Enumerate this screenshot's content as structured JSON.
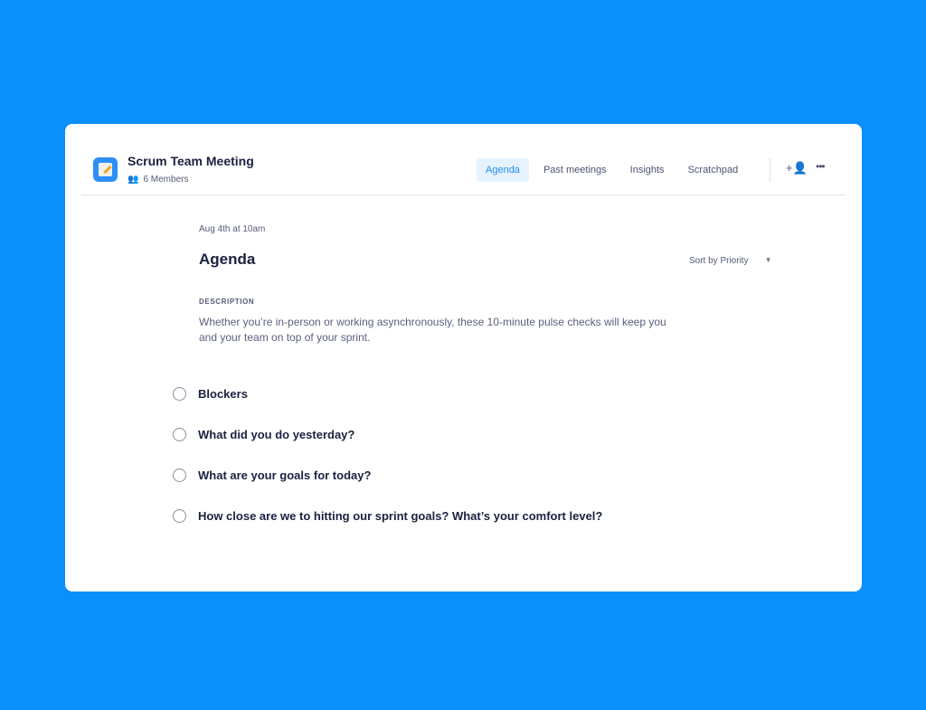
{
  "header": {
    "title": "Scrum Team Meeting",
    "members": "6 Members",
    "tabs": [
      "Agenda",
      "Past meetings",
      "Insights",
      "Scratchpad"
    ],
    "active_tab": "Agenda"
  },
  "main": {
    "date": "Aug 4th at 10am",
    "title": "Agenda",
    "sort": "Sort by Priority",
    "description_label": "DESCRIPTION",
    "description": "Whether you’re in-person or working asynchronously, these 10-minute pulse checks will keep you and your team on top of your sprint.",
    "items": [
      "Blockers",
      "What did you do yesterday?",
      "What are your goals for today?",
      "How close are we to hitting our sprint goals? What’s your comfort level?"
    ]
  },
  "colors": {
    "background": "#0a8ffb",
    "accent": "#1e8ef0"
  }
}
